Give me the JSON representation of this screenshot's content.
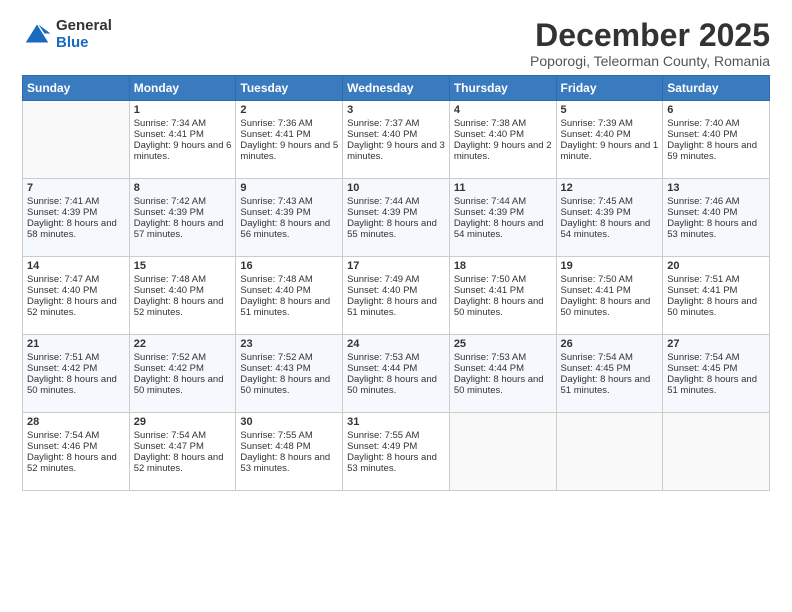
{
  "logo": {
    "general": "General",
    "blue": "Blue"
  },
  "title": "December 2025",
  "subtitle": "Poporogi, Teleorman County, Romania",
  "days_header": [
    "Sunday",
    "Monday",
    "Tuesday",
    "Wednesday",
    "Thursday",
    "Friday",
    "Saturday"
  ],
  "weeks": [
    [
      {
        "day": "",
        "content": ""
      },
      {
        "day": "1",
        "content": "Sunrise: 7:34 AM\nSunset: 4:41 PM\nDaylight: 9 hours and 6 minutes."
      },
      {
        "day": "2",
        "content": "Sunrise: 7:36 AM\nSunset: 4:41 PM\nDaylight: 9 hours and 5 minutes."
      },
      {
        "day": "3",
        "content": "Sunrise: 7:37 AM\nSunset: 4:40 PM\nDaylight: 9 hours and 3 minutes."
      },
      {
        "day": "4",
        "content": "Sunrise: 7:38 AM\nSunset: 4:40 PM\nDaylight: 9 hours and 2 minutes."
      },
      {
        "day": "5",
        "content": "Sunrise: 7:39 AM\nSunset: 4:40 PM\nDaylight: 9 hours and 1 minute."
      },
      {
        "day": "6",
        "content": "Sunrise: 7:40 AM\nSunset: 4:40 PM\nDaylight: 8 hours and 59 minutes."
      }
    ],
    [
      {
        "day": "7",
        "content": "Sunrise: 7:41 AM\nSunset: 4:39 PM\nDaylight: 8 hours and 58 minutes."
      },
      {
        "day": "8",
        "content": "Sunrise: 7:42 AM\nSunset: 4:39 PM\nDaylight: 8 hours and 57 minutes."
      },
      {
        "day": "9",
        "content": "Sunrise: 7:43 AM\nSunset: 4:39 PM\nDaylight: 8 hours and 56 minutes."
      },
      {
        "day": "10",
        "content": "Sunrise: 7:44 AM\nSunset: 4:39 PM\nDaylight: 8 hours and 55 minutes."
      },
      {
        "day": "11",
        "content": "Sunrise: 7:44 AM\nSunset: 4:39 PM\nDaylight: 8 hours and 54 minutes."
      },
      {
        "day": "12",
        "content": "Sunrise: 7:45 AM\nSunset: 4:39 PM\nDaylight: 8 hours and 54 minutes."
      },
      {
        "day": "13",
        "content": "Sunrise: 7:46 AM\nSunset: 4:40 PM\nDaylight: 8 hours and 53 minutes."
      }
    ],
    [
      {
        "day": "14",
        "content": "Sunrise: 7:47 AM\nSunset: 4:40 PM\nDaylight: 8 hours and 52 minutes."
      },
      {
        "day": "15",
        "content": "Sunrise: 7:48 AM\nSunset: 4:40 PM\nDaylight: 8 hours and 52 minutes."
      },
      {
        "day": "16",
        "content": "Sunrise: 7:48 AM\nSunset: 4:40 PM\nDaylight: 8 hours and 51 minutes."
      },
      {
        "day": "17",
        "content": "Sunrise: 7:49 AM\nSunset: 4:40 PM\nDaylight: 8 hours and 51 minutes."
      },
      {
        "day": "18",
        "content": "Sunrise: 7:50 AM\nSunset: 4:41 PM\nDaylight: 8 hours and 50 minutes."
      },
      {
        "day": "19",
        "content": "Sunrise: 7:50 AM\nSunset: 4:41 PM\nDaylight: 8 hours and 50 minutes."
      },
      {
        "day": "20",
        "content": "Sunrise: 7:51 AM\nSunset: 4:41 PM\nDaylight: 8 hours and 50 minutes."
      }
    ],
    [
      {
        "day": "21",
        "content": "Sunrise: 7:51 AM\nSunset: 4:42 PM\nDaylight: 8 hours and 50 minutes."
      },
      {
        "day": "22",
        "content": "Sunrise: 7:52 AM\nSunset: 4:42 PM\nDaylight: 8 hours and 50 minutes."
      },
      {
        "day": "23",
        "content": "Sunrise: 7:52 AM\nSunset: 4:43 PM\nDaylight: 8 hours and 50 minutes."
      },
      {
        "day": "24",
        "content": "Sunrise: 7:53 AM\nSunset: 4:44 PM\nDaylight: 8 hours and 50 minutes."
      },
      {
        "day": "25",
        "content": "Sunrise: 7:53 AM\nSunset: 4:44 PM\nDaylight: 8 hours and 50 minutes."
      },
      {
        "day": "26",
        "content": "Sunrise: 7:54 AM\nSunset: 4:45 PM\nDaylight: 8 hours and 51 minutes."
      },
      {
        "day": "27",
        "content": "Sunrise: 7:54 AM\nSunset: 4:45 PM\nDaylight: 8 hours and 51 minutes."
      }
    ],
    [
      {
        "day": "28",
        "content": "Sunrise: 7:54 AM\nSunset: 4:46 PM\nDaylight: 8 hours and 52 minutes."
      },
      {
        "day": "29",
        "content": "Sunrise: 7:54 AM\nSunset: 4:47 PM\nDaylight: 8 hours and 52 minutes."
      },
      {
        "day": "30",
        "content": "Sunrise: 7:55 AM\nSunset: 4:48 PM\nDaylight: 8 hours and 53 minutes."
      },
      {
        "day": "31",
        "content": "Sunrise: 7:55 AM\nSunset: 4:49 PM\nDaylight: 8 hours and 53 minutes."
      },
      {
        "day": "",
        "content": ""
      },
      {
        "day": "",
        "content": ""
      },
      {
        "day": "",
        "content": ""
      }
    ]
  ]
}
